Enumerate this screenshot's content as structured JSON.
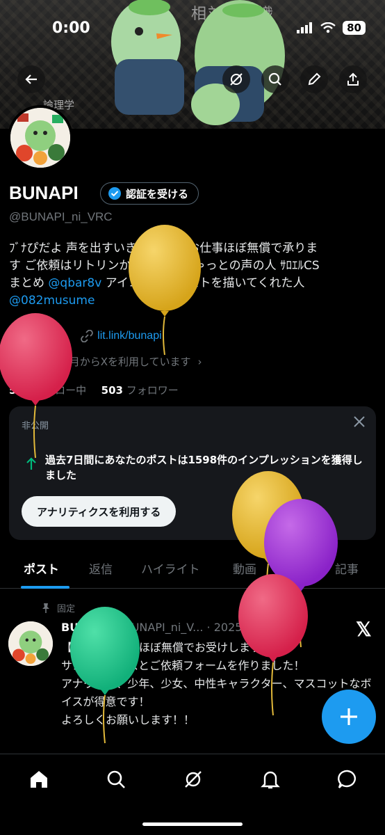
{
  "status_bar": {
    "time": "0:00",
    "battery": "80"
  },
  "banner": {
    "sign_text": "相対　知識",
    "side_text": "論理学"
  },
  "profile": {
    "name": "BUNAPI",
    "verify_label": "認証を受ける",
    "handle": "@BUNAPI_ni_VRC",
    "bio_line1": "ﾌﾞﾅぴだよ 声を出すいきもの 声のお仕事ほぼ無償で承りま",
    "bio_line2": "す ご依頼はリトリンから いじょきゃっとの声の人 ｻﾛｴﾙCS",
    "bio_line3_prefix": "まとめ ",
    "bio_link1": "@qbar8v",
    "bio_line3_suffix": " アイコンのイラストを描いてくれた人",
    "bio_link2": "@082musume",
    "location": "ぶちゃ",
    "url": "lit.link/bunapi",
    "joined": "2024年6月からXを利用しています",
    "following_count": "506",
    "following_label": "フォロー中",
    "followers_count": "503",
    "followers_label": "フォロワー"
  },
  "analytics_card": {
    "private_label": "非公開",
    "message": "過去7日間にあなたのポストは1598件のインプレッションを獲得しました",
    "cta": "アナリティクスを利用する"
  },
  "tabs": [
    "ポスト",
    "返信",
    "ハイライト",
    "動画",
    "画像",
    "記事"
  ],
  "pinned_post": {
    "pinned_label": "固定",
    "author": "BUNAPI",
    "handle": "@BUNAPI_ni_V...",
    "date": "· 2025/09/22",
    "text": "【声のご依頼をほぼ無償でお受けします】\nサンプルボイスとご依頼フォームを作りました！\nアナウンス、少年、少女、中性キャラクター、マスコットなボイスが得意です！\nよろしくお願いします！！"
  },
  "colors": {
    "accent": "#1d9bf0",
    "background": "#000000",
    "card": "#16181c",
    "muted": "#71767b"
  }
}
